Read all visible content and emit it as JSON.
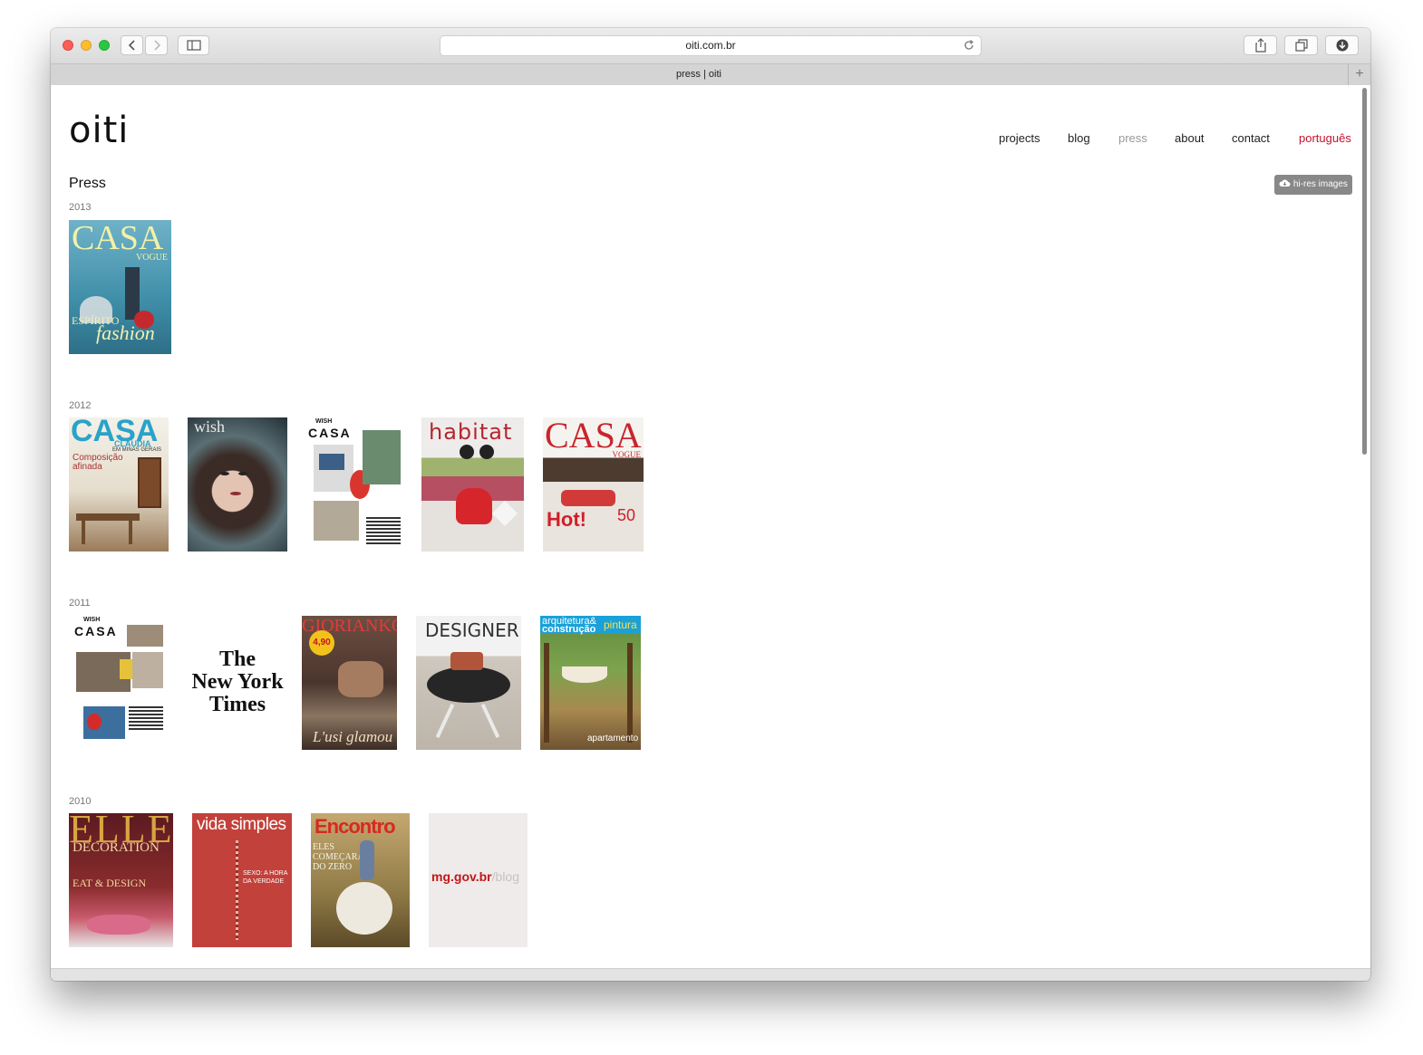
{
  "browser": {
    "url": "oiti.com.br",
    "tab_title": "press | oiti",
    "new_tab": "+"
  },
  "site": {
    "logo": "oiti",
    "nav": [
      "projects",
      "blog",
      "press",
      "about",
      "contact",
      "português"
    ],
    "page_title": "Press",
    "hires_button": "hi-res images"
  },
  "years": [
    "2013",
    "2012",
    "2011",
    "2010"
  ],
  "covers": {
    "casavogue2013": {
      "title": "CASA",
      "sub": "VOGUE",
      "tag": "ESPÍRITO",
      "tag2": "fashion"
    },
    "casaclaudia": {
      "title": "CASA",
      "sub": "CLAUDIA",
      "sub2": "EM MINAS GERAIS",
      "headline": "Composição afinada"
    },
    "wish": {
      "title": "wish"
    },
    "wishcasa2012": {
      "top": "WISH",
      "title": "CASA"
    },
    "habitat": {
      "title": "habitat"
    },
    "casavogue2012": {
      "title": "CASA",
      "sub": "VOGUE",
      "hot": "Hot!",
      "num": "50"
    },
    "wishcasa2011": {
      "top": "WISH",
      "title": "CASA"
    },
    "nyt": {
      "line1": "The",
      "line2": "New York",
      "line3": "Times"
    },
    "gioriankol": {
      "title": "GIORIANKOL",
      "price": "4,90",
      "footer": "L'usi glamou"
    },
    "designer": {
      "title": "DESIGNER"
    },
    "arquitetura": {
      "title1": "arquitetura&",
      "title2": "construção",
      "tag": "pintura",
      "footer": "apartamento"
    },
    "elle": {
      "title": "ELLE",
      "sub": "DECORATION",
      "tag": "EAT & DESIGN"
    },
    "vidasimples": {
      "title": "vida simples",
      "headline": "SEXO: A HORA DA VERDADE"
    },
    "encontro": {
      "title": "Encontro",
      "headline": "ELES COMEÇARAM DO ZERO"
    },
    "mggov": {
      "main": "mg.gov.br",
      "suffix": "/blog"
    }
  }
}
